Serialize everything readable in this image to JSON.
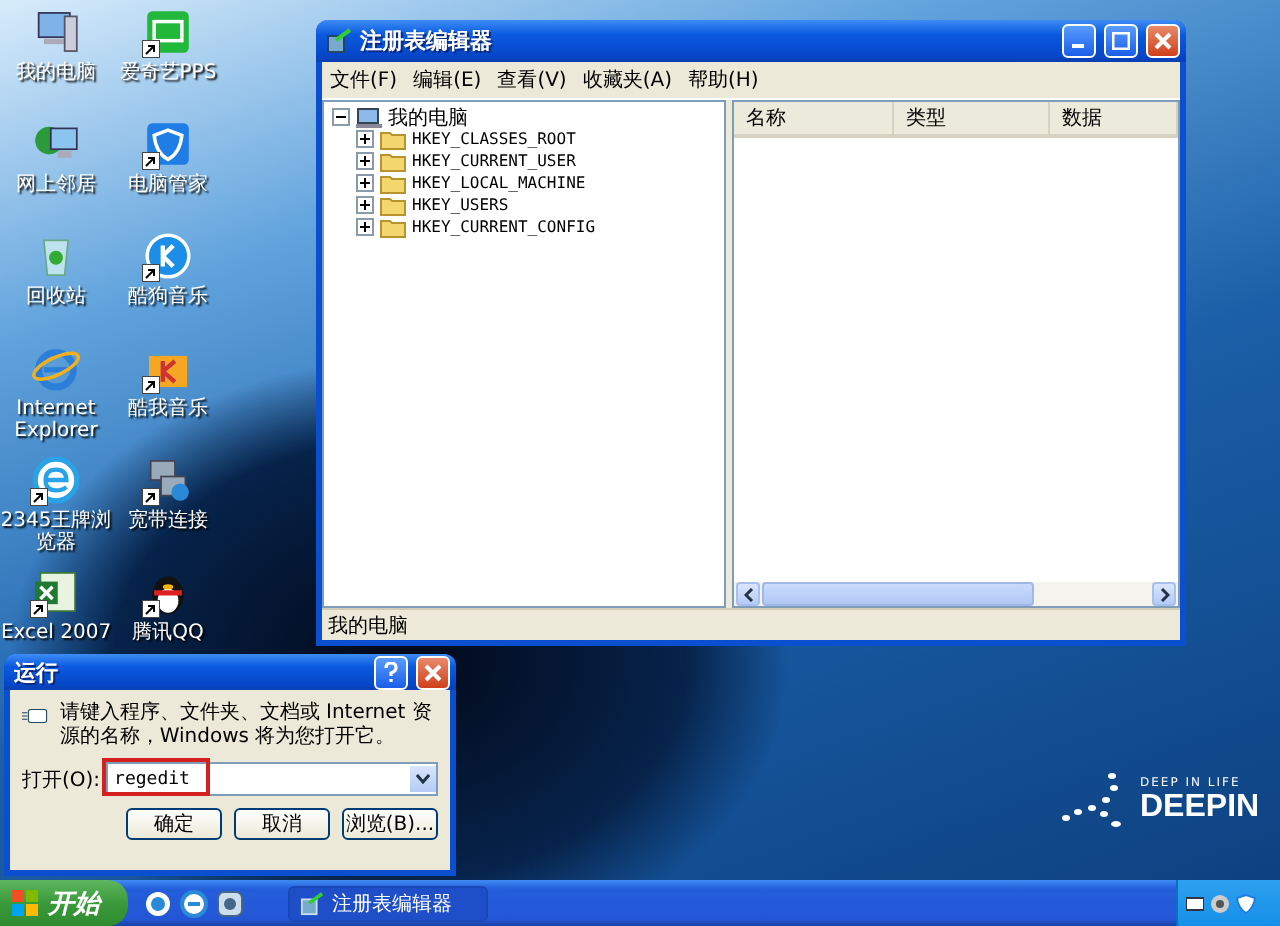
{
  "desktop_icons": [
    {
      "label": "我的电脑",
      "kind": "computer",
      "shortcut": false
    },
    {
      "label": "爱奇艺PPS",
      "kind": "video",
      "shortcut": true
    },
    {
      "label": "网上邻居",
      "kind": "network",
      "shortcut": false
    },
    {
      "label": "电脑管家",
      "kind": "shield",
      "shortcut": true
    },
    {
      "label": "回收站",
      "kind": "recycle",
      "shortcut": false
    },
    {
      "label": "酷狗音乐",
      "kind": "music_circle",
      "shortcut": true
    },
    {
      "label": "Internet Explorer",
      "kind": "ie",
      "shortcut": false
    },
    {
      "label": "酷我音乐",
      "kind": "music_box",
      "shortcut": true
    },
    {
      "label": "2345王牌浏览器",
      "kind": "browser",
      "shortcut": true
    },
    {
      "label": "宽带连接",
      "kind": "broadband",
      "shortcut": true
    },
    {
      "label": "Excel 2007",
      "kind": "excel",
      "shortcut": true
    },
    {
      "label": "腾讯QQ",
      "kind": "penguin",
      "shortcut": true
    }
  ],
  "regedit": {
    "title": "注册表编辑器",
    "menu": [
      "文件(F)",
      "编辑(E)",
      "查看(V)",
      "收藏夹(A)",
      "帮助(H)"
    ],
    "tree": {
      "label": "我的电脑",
      "expanded": true,
      "children": [
        {
          "label": "HKEY_CLASSES_ROOT",
          "expanded": false
        },
        {
          "label": "HKEY_CURRENT_USER",
          "expanded": false
        },
        {
          "label": "HKEY_LOCAL_MACHINE",
          "expanded": false
        },
        {
          "label": "HKEY_USERS",
          "expanded": false
        },
        {
          "label": "HKEY_CURRENT_CONFIG",
          "expanded": false
        }
      ]
    },
    "columns": [
      "名称",
      "类型",
      "数据"
    ],
    "status_bar": "我的电脑"
  },
  "run_dialog": {
    "title": "运行",
    "description": "请键入程序、文件夹、文档或 Internet 资源的名称，Windows 将为您打开它。",
    "input": {
      "label": "打开(O):",
      "value": "regedit",
      "highlighted": true
    },
    "buttons": [
      "确定",
      "取消",
      "浏览(B)..."
    ]
  },
  "logo": {
    "tagline": "DEEP IN LIFE",
    "name": "DEEPIN"
  },
  "taskbar": {
    "start": "开始",
    "tasks": [
      {
        "label": "注册表编辑器"
      }
    ]
  }
}
